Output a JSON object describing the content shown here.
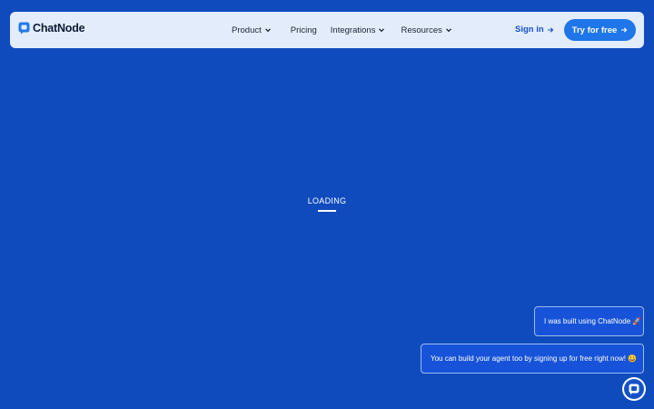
{
  "brand": {
    "name": "ChatNode",
    "logo_icon": "chat-square-icon",
    "accent": "#1e76e8",
    "background": "#0f4bbd"
  },
  "nav": {
    "items": [
      {
        "label": "Product",
        "dropdown": true
      },
      {
        "label": "Pricing",
        "dropdown": false
      },
      {
        "label": "Integrations",
        "dropdown": true
      },
      {
        "label": "Resources",
        "dropdown": true
      }
    ],
    "sign_in_label": "Sign in",
    "cta_label": "Try for free"
  },
  "main": {
    "loading_text": "LOADING"
  },
  "chat_widget": {
    "messages": [
      "I was built using ChatNode 🚀",
      "You can build your agent too by signing up for free right now! 😀"
    ],
    "launcher_icon": "chat-bubble-icon"
  }
}
